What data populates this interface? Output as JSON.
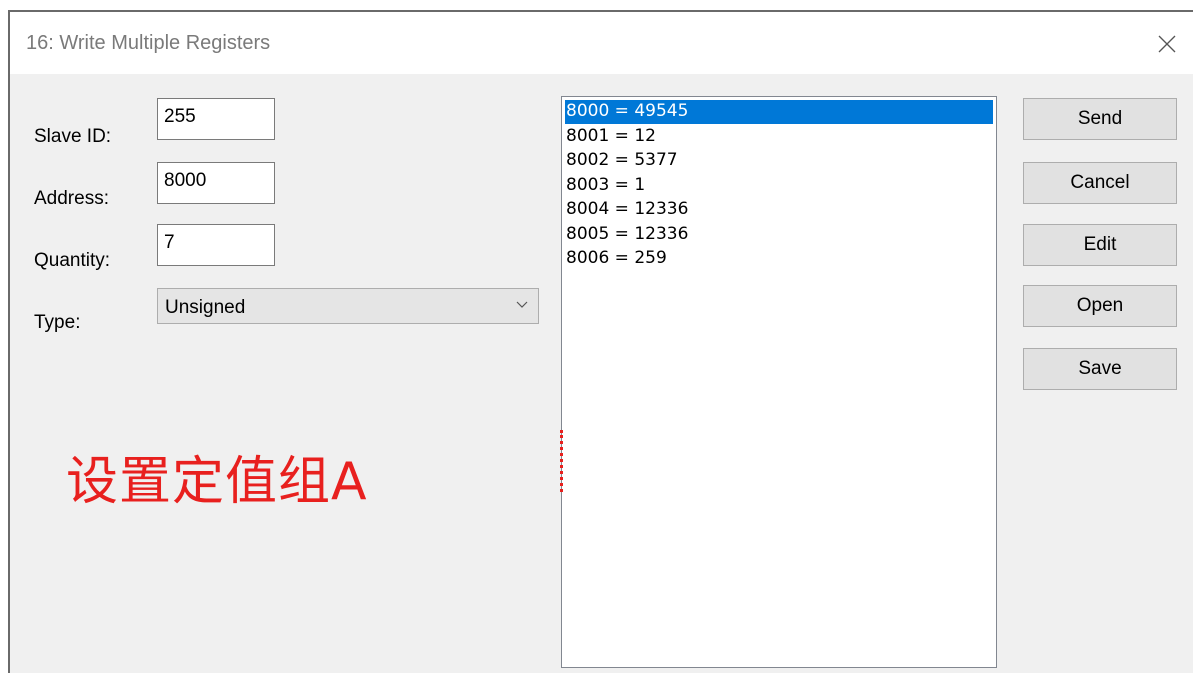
{
  "window": {
    "title": "16: Write Multiple Registers",
    "close_icon": "close-icon"
  },
  "form": {
    "slave_id": {
      "label": "Slave ID:",
      "value": "255"
    },
    "address": {
      "label": "Address:",
      "value": "8000"
    },
    "quantity": {
      "label": "Quantity:",
      "value": "7"
    },
    "type": {
      "label": "Type:",
      "selected": "Unsigned"
    }
  },
  "registers": [
    "8000 = 49545",
    "8001 = 12",
    "8002 = 5377",
    "8003 = 1",
    "8004 = 12336",
    "8005 = 12336",
    "8006 = 259"
  ],
  "selected_register_index": 0,
  "buttons": {
    "send": "Send",
    "cancel": "Cancel",
    "edit": "Edit",
    "open": "Open",
    "save": "Save"
  },
  "annotation": {
    "text": "设置定值组A",
    "color": "#e8201e"
  },
  "colors": {
    "selection": "#0078d7"
  }
}
